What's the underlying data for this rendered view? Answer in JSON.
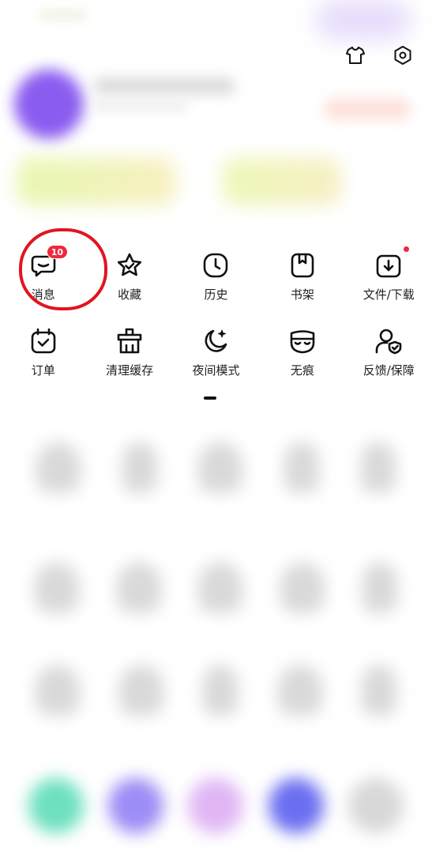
{
  "menu": {
    "row1": [
      {
        "label": "消息",
        "icon": "message-icon",
        "badge": "10"
      },
      {
        "label": "收藏",
        "icon": "star-icon"
      },
      {
        "label": "历史",
        "icon": "clock-icon"
      },
      {
        "label": "书架",
        "icon": "bookshelf-icon"
      },
      {
        "label": "文件/下载",
        "icon": "download-icon",
        "dot": true
      }
    ],
    "row2": [
      {
        "label": "订单",
        "icon": "order-icon"
      },
      {
        "label": "清理缓存",
        "icon": "clear-cache-icon"
      },
      {
        "label": "夜间模式",
        "icon": "night-mode-icon"
      },
      {
        "label": "无痕",
        "icon": "incognito-icon"
      },
      {
        "label": "反馈/保障",
        "icon": "feedback-icon"
      }
    ]
  },
  "header": {
    "icons": [
      "shirt-icon",
      "settings-icon"
    ]
  },
  "colors": {
    "badge": "#f0283c",
    "highlight": "#e2141e"
  }
}
